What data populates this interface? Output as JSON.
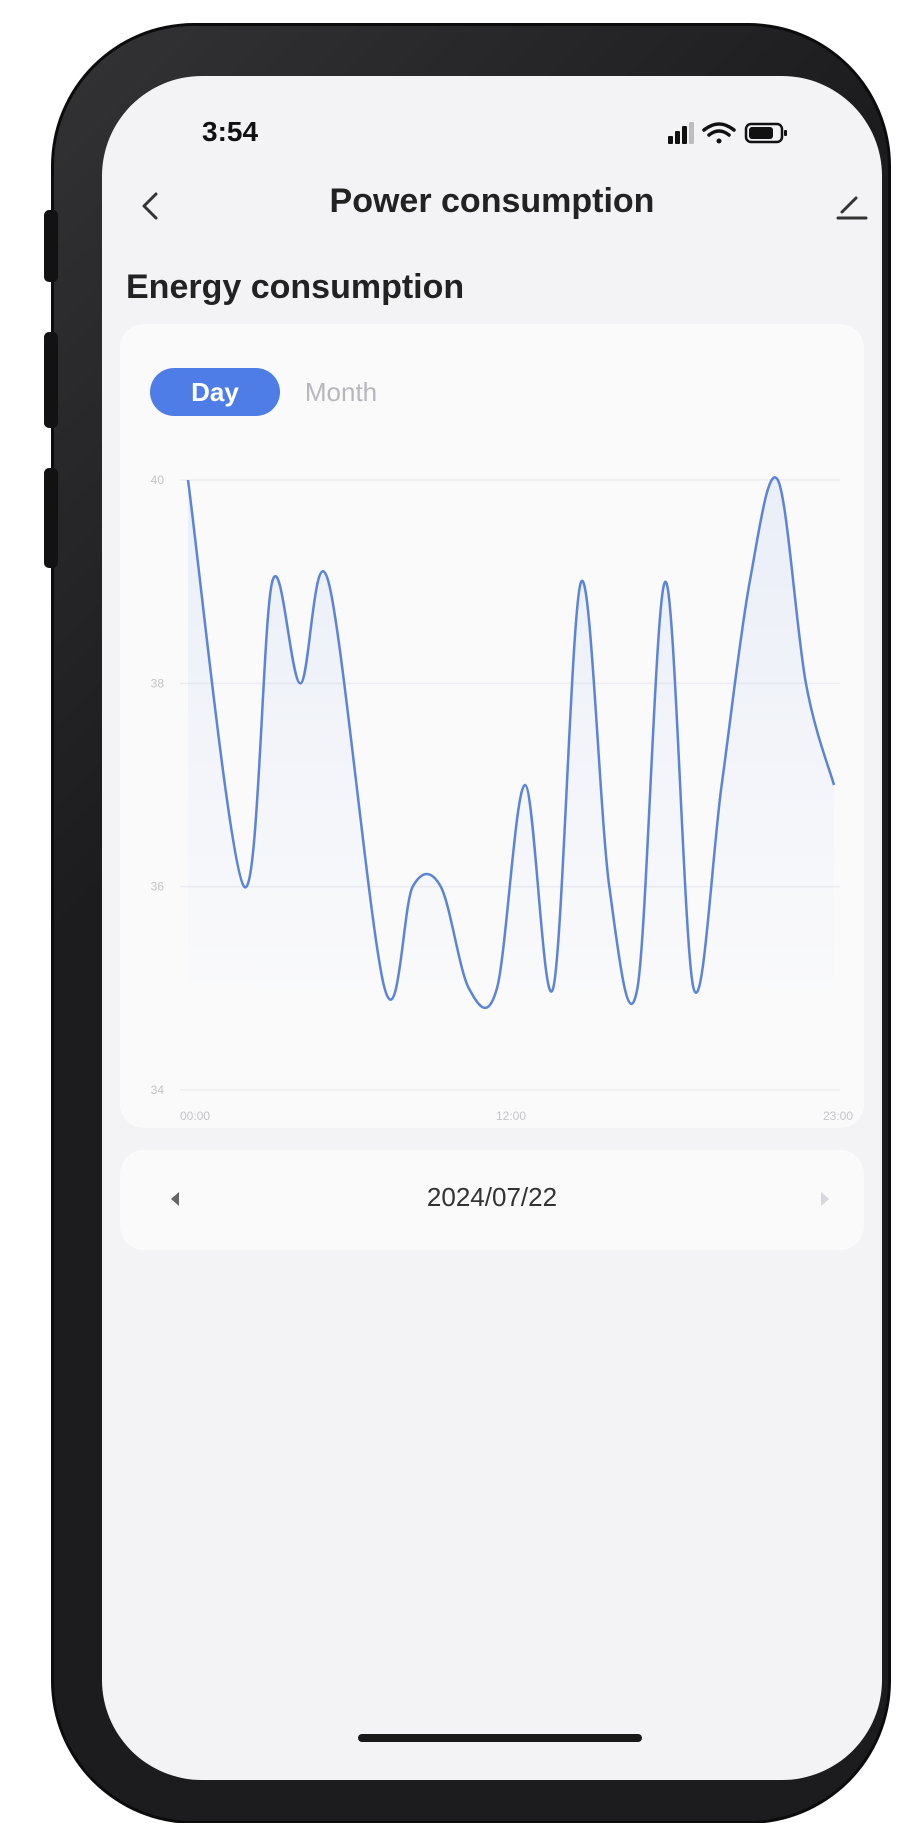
{
  "status_bar": {
    "time": "3:54"
  },
  "nav": {
    "title": "Power consumption"
  },
  "section": {
    "title": "Energy consumption"
  },
  "tabs": [
    {
      "label": "Day",
      "active": true
    },
    {
      "label": "Month",
      "active": false
    }
  ],
  "chart_data": {
    "type": "area",
    "title": "",
    "xlabel": "",
    "ylabel": "",
    "x_tick_labels": [
      "00:00",
      "12:00",
      "23:00"
    ],
    "y_tick_labels": [
      "34",
      "36",
      "38",
      "40"
    ],
    "ylim": [
      34,
      40
    ],
    "xlim": [
      0,
      23
    ],
    "grid": true,
    "series": [
      {
        "color": "#5b84d8",
        "x": [
          0,
          2,
          3,
          4,
          5,
          7,
          8,
          9,
          10,
          11,
          12,
          13,
          14,
          15,
          16,
          17,
          18,
          19,
          20,
          21,
          22,
          23
        ],
        "values": [
          40,
          36,
          39,
          38,
          39,
          35,
          36,
          36,
          35,
          35,
          37,
          35,
          39,
          36,
          35,
          39,
          35,
          37,
          39,
          40,
          38,
          37
        ]
      }
    ]
  },
  "date_nav": {
    "date": "2024/07/22"
  },
  "colors": {
    "accent": "#4e7de8",
    "line": "#5b84d8",
    "background": "#f3f3f5"
  }
}
